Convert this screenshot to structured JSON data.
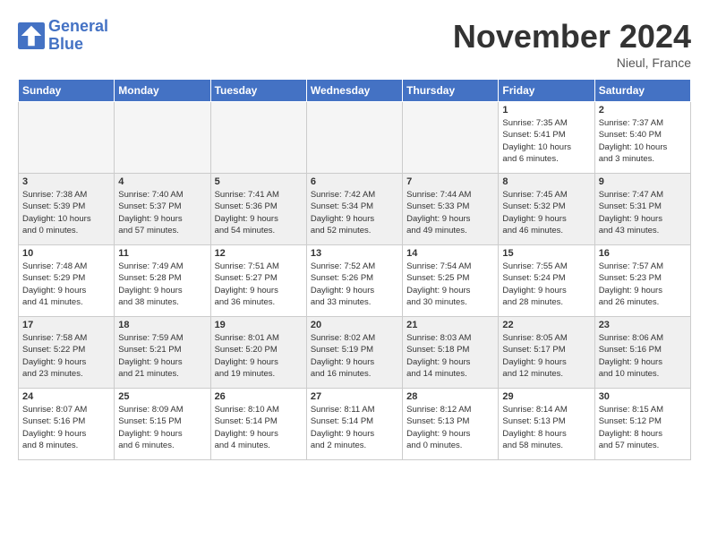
{
  "header": {
    "logo_line1": "General",
    "logo_line2": "Blue",
    "month": "November 2024",
    "location": "Nieul, France"
  },
  "days_of_week": [
    "Sunday",
    "Monday",
    "Tuesday",
    "Wednesday",
    "Thursday",
    "Friday",
    "Saturday"
  ],
  "weeks": [
    [
      {
        "day": "",
        "info": "",
        "empty": true
      },
      {
        "day": "",
        "info": "",
        "empty": true
      },
      {
        "day": "",
        "info": "",
        "empty": true
      },
      {
        "day": "",
        "info": "",
        "empty": true
      },
      {
        "day": "",
        "info": "",
        "empty": true
      },
      {
        "day": "1",
        "info": "Sunrise: 7:35 AM\nSunset: 5:41 PM\nDaylight: 10 hours\nand 6 minutes."
      },
      {
        "day": "2",
        "info": "Sunrise: 7:37 AM\nSunset: 5:40 PM\nDaylight: 10 hours\nand 3 minutes."
      }
    ],
    [
      {
        "day": "3",
        "info": "Sunrise: 7:38 AM\nSunset: 5:39 PM\nDaylight: 10 hours\nand 0 minutes."
      },
      {
        "day": "4",
        "info": "Sunrise: 7:40 AM\nSunset: 5:37 PM\nDaylight: 9 hours\nand 57 minutes."
      },
      {
        "day": "5",
        "info": "Sunrise: 7:41 AM\nSunset: 5:36 PM\nDaylight: 9 hours\nand 54 minutes."
      },
      {
        "day": "6",
        "info": "Sunrise: 7:42 AM\nSunset: 5:34 PM\nDaylight: 9 hours\nand 52 minutes."
      },
      {
        "day": "7",
        "info": "Sunrise: 7:44 AM\nSunset: 5:33 PM\nDaylight: 9 hours\nand 49 minutes."
      },
      {
        "day": "8",
        "info": "Sunrise: 7:45 AM\nSunset: 5:32 PM\nDaylight: 9 hours\nand 46 minutes."
      },
      {
        "day": "9",
        "info": "Sunrise: 7:47 AM\nSunset: 5:31 PM\nDaylight: 9 hours\nand 43 minutes."
      }
    ],
    [
      {
        "day": "10",
        "info": "Sunrise: 7:48 AM\nSunset: 5:29 PM\nDaylight: 9 hours\nand 41 minutes."
      },
      {
        "day": "11",
        "info": "Sunrise: 7:49 AM\nSunset: 5:28 PM\nDaylight: 9 hours\nand 38 minutes."
      },
      {
        "day": "12",
        "info": "Sunrise: 7:51 AM\nSunset: 5:27 PM\nDaylight: 9 hours\nand 36 minutes."
      },
      {
        "day": "13",
        "info": "Sunrise: 7:52 AM\nSunset: 5:26 PM\nDaylight: 9 hours\nand 33 minutes."
      },
      {
        "day": "14",
        "info": "Sunrise: 7:54 AM\nSunset: 5:25 PM\nDaylight: 9 hours\nand 30 minutes."
      },
      {
        "day": "15",
        "info": "Sunrise: 7:55 AM\nSunset: 5:24 PM\nDaylight: 9 hours\nand 28 minutes."
      },
      {
        "day": "16",
        "info": "Sunrise: 7:57 AM\nSunset: 5:23 PM\nDaylight: 9 hours\nand 26 minutes."
      }
    ],
    [
      {
        "day": "17",
        "info": "Sunrise: 7:58 AM\nSunset: 5:22 PM\nDaylight: 9 hours\nand 23 minutes."
      },
      {
        "day": "18",
        "info": "Sunrise: 7:59 AM\nSunset: 5:21 PM\nDaylight: 9 hours\nand 21 minutes."
      },
      {
        "day": "19",
        "info": "Sunrise: 8:01 AM\nSunset: 5:20 PM\nDaylight: 9 hours\nand 19 minutes."
      },
      {
        "day": "20",
        "info": "Sunrise: 8:02 AM\nSunset: 5:19 PM\nDaylight: 9 hours\nand 16 minutes."
      },
      {
        "day": "21",
        "info": "Sunrise: 8:03 AM\nSunset: 5:18 PM\nDaylight: 9 hours\nand 14 minutes."
      },
      {
        "day": "22",
        "info": "Sunrise: 8:05 AM\nSunset: 5:17 PM\nDaylight: 9 hours\nand 12 minutes."
      },
      {
        "day": "23",
        "info": "Sunrise: 8:06 AM\nSunset: 5:16 PM\nDaylight: 9 hours\nand 10 minutes."
      }
    ],
    [
      {
        "day": "24",
        "info": "Sunrise: 8:07 AM\nSunset: 5:16 PM\nDaylight: 9 hours\nand 8 minutes."
      },
      {
        "day": "25",
        "info": "Sunrise: 8:09 AM\nSunset: 5:15 PM\nDaylight: 9 hours\nand 6 minutes."
      },
      {
        "day": "26",
        "info": "Sunrise: 8:10 AM\nSunset: 5:14 PM\nDaylight: 9 hours\nand 4 minutes."
      },
      {
        "day": "27",
        "info": "Sunrise: 8:11 AM\nSunset: 5:14 PM\nDaylight: 9 hours\nand 2 minutes."
      },
      {
        "day": "28",
        "info": "Sunrise: 8:12 AM\nSunset: 5:13 PM\nDaylight: 9 hours\nand 0 minutes."
      },
      {
        "day": "29",
        "info": "Sunrise: 8:14 AM\nSunset: 5:13 PM\nDaylight: 8 hours\nand 58 minutes."
      },
      {
        "day": "30",
        "info": "Sunrise: 8:15 AM\nSunset: 5:12 PM\nDaylight: 8 hours\nand 57 minutes."
      }
    ]
  ]
}
